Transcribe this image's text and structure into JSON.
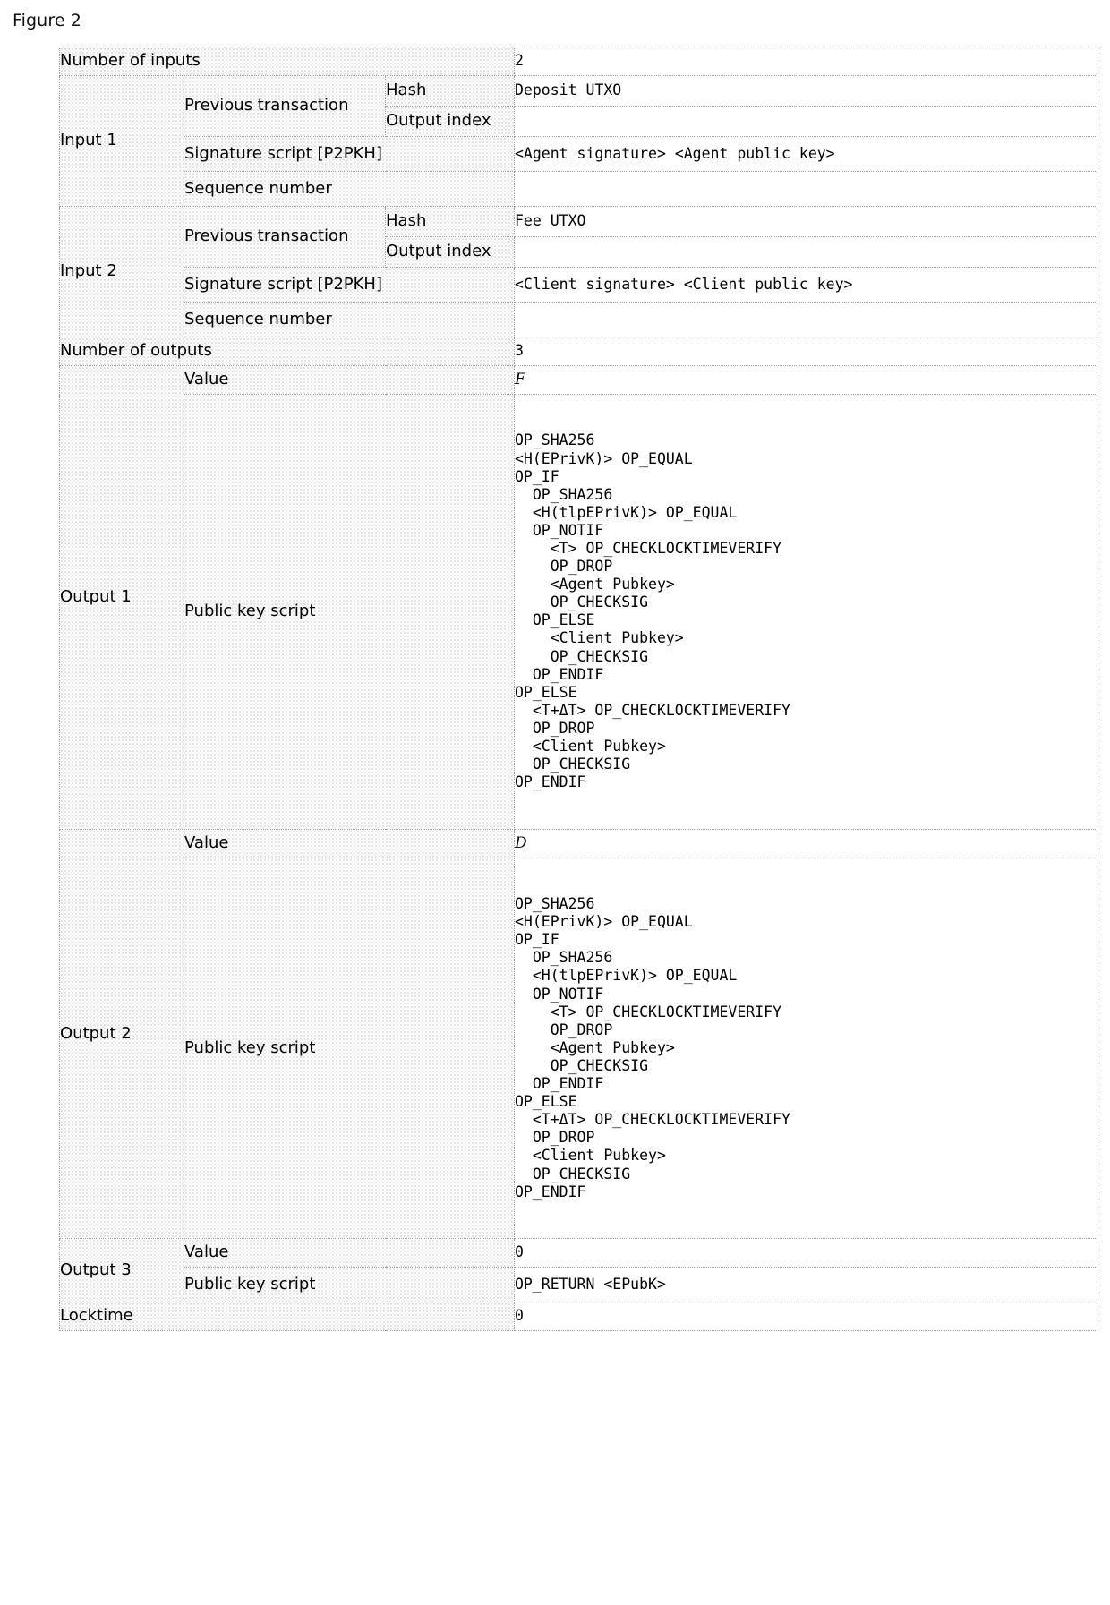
{
  "figure": {
    "caption": "Figure 2"
  },
  "table": {
    "rows": {
      "number_of_inputs_label": "Number of inputs",
      "number_of_inputs_value": "2",
      "number_of_outputs_label": "Number of outputs",
      "number_of_outputs_value": "3",
      "locktime_label": "Locktime",
      "locktime_value": "0"
    },
    "field_labels": {
      "previous_transaction": "Previous transaction",
      "hash": "Hash",
      "output_index": "Output index",
      "signature_script": "Signature script [P2PKH]",
      "sequence_number": "Sequence number",
      "value": "Value",
      "public_key_script": "Public key script"
    },
    "inputs": [
      {
        "label": "Input 1",
        "prev_tx_hash": "Deposit UTXO",
        "prev_tx_output_index": "",
        "signature_script": "<Agent signature> <Agent public key>",
        "sequence_number": ""
      },
      {
        "label": "Input 2",
        "prev_tx_hash": "Fee UTXO",
        "prev_tx_output_index": "",
        "signature_script": "<Client signature> <Client public key>",
        "sequence_number": ""
      }
    ],
    "outputs": [
      {
        "label": "Output 1",
        "value": "F",
        "value_italic": true,
        "public_key_script": "OP_SHA256\n<H(EPrivK)> OP_EQUAL\nOP_IF\n  OP_SHA256\n  <H(tlpEPrivK)> OP_EQUAL\n  OP_NOTIF\n    <T> OP_CHECKLOCKTIMEVERIFY\n    OP_DROP\n    <Agent Pubkey>\n    OP_CHECKSIG\n  OP_ELSE\n    <Client Pubkey>\n    OP_CHECKSIG\n  OP_ENDIF\nOP_ELSE\n  <T+ΔT> OP_CHECKLOCKTIMEVERIFY\n  OP_DROP\n  <Client Pubkey>\n  OP_CHECKSIG\nOP_ENDIF"
      },
      {
        "label": "Output 2",
        "value": "D",
        "value_italic": true,
        "public_key_script": "OP_SHA256\n<H(EPrivK)> OP_EQUAL\nOP_IF\n  OP_SHA256\n  <H(tlpEPrivK)> OP_EQUAL\n  OP_NOTIF\n    <T> OP_CHECKLOCKTIMEVERIFY\n    OP_DROP\n    <Agent Pubkey>\n    OP_CHECKSIG\n  OP_ENDIF\nOP_ELSE\n  <T+ΔT> OP_CHECKLOCKTIMEVERIFY\n  OP_DROP\n  <Client Pubkey>\n  OP_CHECKSIG\nOP_ENDIF"
      },
      {
        "label": "Output 3",
        "value": "0",
        "value_italic": false,
        "public_key_script": "OP_RETURN <EPubK>"
      }
    ]
  }
}
